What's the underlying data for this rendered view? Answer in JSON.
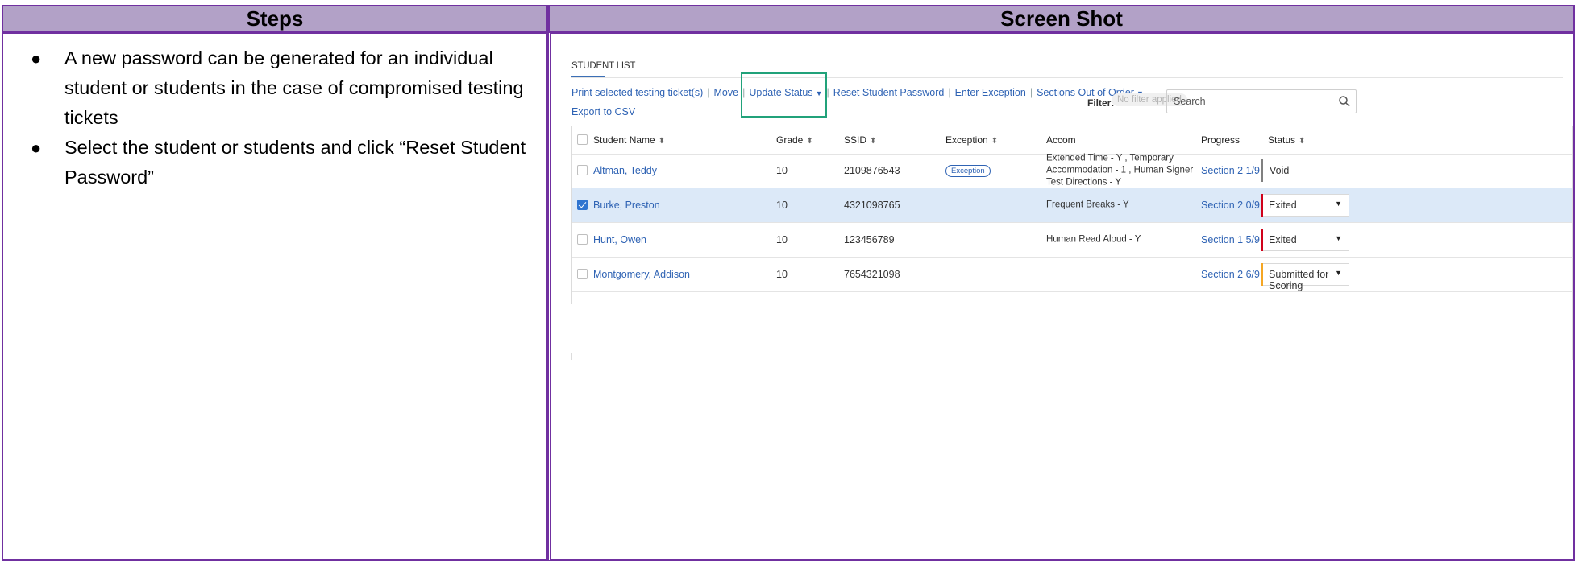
{
  "doc": {
    "col_steps_header": "Steps",
    "col_shot_header": "Screen Shot",
    "steps": [
      "A new password can be generated for an individual student or students in the case of compromised testing tickets",
      "Select the student or students and click “Reset Student Password”"
    ]
  },
  "app": {
    "tab_title": "STUDENT LIST",
    "actions": {
      "print": "Print selected testing ticket(s)",
      "move": "Move",
      "update_status": "Update Status",
      "reset_password": "Reset Student Password",
      "enter_exception": "Enter Exception",
      "sections_out_of_order": "Sections Out of Order",
      "export_csv": "Export to CSV"
    },
    "filter": {
      "label": "Filter:",
      "chip": "No filter applied"
    },
    "search": {
      "placeholder": "Search"
    },
    "columns": {
      "name": "Student Name",
      "grade": "Grade",
      "ssid": "SSID",
      "exception": "Exception",
      "accom": "Accom",
      "progress": "Progress",
      "status": "Status"
    },
    "rows": [
      {
        "name": "Altman, Teddy",
        "grade": "10",
        "ssid": "2109876543",
        "exception": "Exception",
        "accom": "Extended Time - Y , Temporary Accommodation - 1 , Human Signer Test Directions - Y",
        "progress": "Section 2 1/9",
        "status": "Void",
        "status_color": "#808080",
        "selected": false
      },
      {
        "name": "Burke, Preston",
        "grade": "10",
        "ssid": "4321098765",
        "exception": "",
        "accom": "Frequent Breaks - Y",
        "progress": "Section 2 0/9",
        "status": "Exited",
        "status_color": "#d0021b",
        "selected": true
      },
      {
        "name": "Hunt, Owen",
        "grade": "10",
        "ssid": "123456789",
        "exception": "",
        "accom": "Human Read Aloud - Y",
        "progress": "Section 1 5/9",
        "status": "Exited",
        "status_color": "#d0021b",
        "selected": false
      },
      {
        "name": "Montgomery, Addison",
        "grade": "10",
        "ssid": "7654321098",
        "exception": "",
        "accom": "",
        "progress": "Section 2 6/9",
        "status": "Submitted for Scoring",
        "status_color": "#f5a623",
        "selected": false
      }
    ],
    "colors": {
      "accent": "#2f63b4",
      "highlight": "#21a27a",
      "header_bg": "#b2a1c7",
      "border": "#7030a0"
    }
  }
}
